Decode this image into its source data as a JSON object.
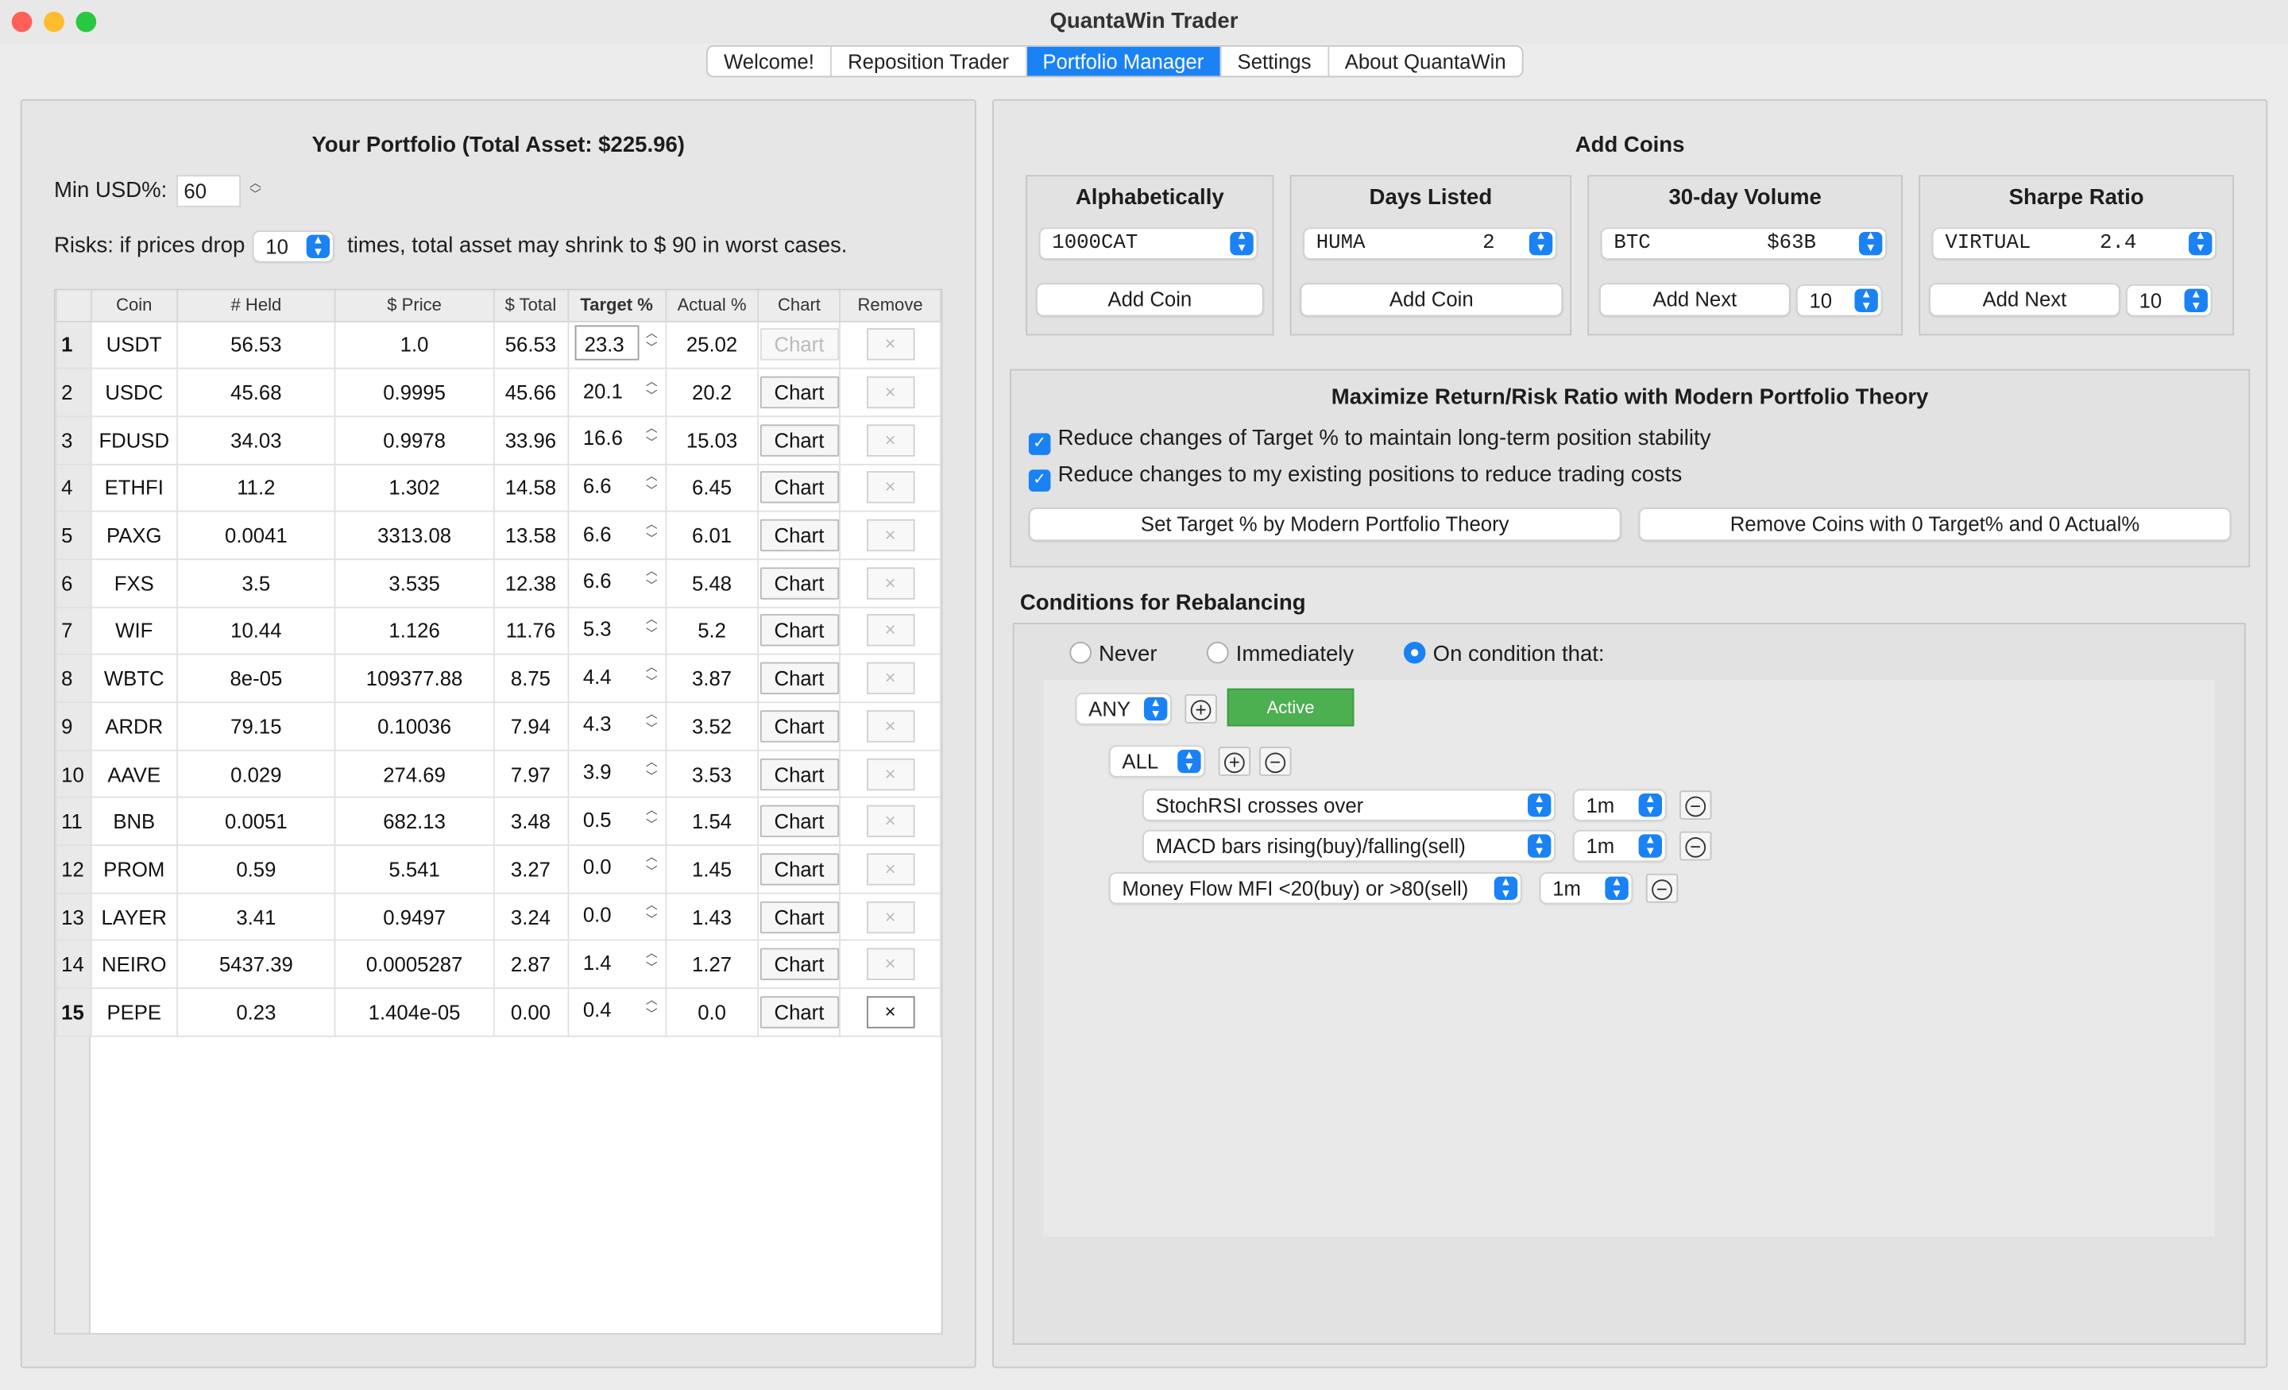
{
  "window": {
    "title": "QuantaWin Trader"
  },
  "tabs": [
    "Welcome!",
    "Reposition Trader",
    "Portfolio Manager",
    "Settings",
    "About QuantaWin"
  ],
  "portfolio": {
    "title": "Your Portfolio (Total Asset: $225.96)",
    "min_usd_label": "Min USD%:",
    "min_usd_value": "60",
    "risks_prefix": "Risks: if prices drop",
    "risks_times": "10",
    "risks_suffix": "times, total asset may shrink to $ 90  in worst cases.",
    "columns": [
      "Coin",
      "# Held",
      "$ Price",
      "$ Total",
      "Target %",
      "Actual %",
      "Chart",
      "Remove"
    ],
    "chart_label": "Chart",
    "remove_label": "×",
    "rows": [
      {
        "n": "1",
        "coin": "USDT",
        "held": "56.53",
        "price": "1.0",
        "total": "56.53",
        "target": "23.3",
        "actual": "25.02"
      },
      {
        "n": "2",
        "coin": "USDC",
        "held": "45.68",
        "price": "0.9995",
        "total": "45.66",
        "target": "20.1",
        "actual": "20.2"
      },
      {
        "n": "3",
        "coin": "FDUSD",
        "held": "34.03",
        "price": "0.9978",
        "total": "33.96",
        "target": "16.6",
        "actual": "15.03"
      },
      {
        "n": "4",
        "coin": "ETHFI",
        "held": "11.2",
        "price": "1.302",
        "total": "14.58",
        "target": "6.6",
        "actual": "6.45"
      },
      {
        "n": "5",
        "coin": "PAXG",
        "held": "0.0041",
        "price": "3313.08",
        "total": "13.58",
        "target": "6.6",
        "actual": "6.01"
      },
      {
        "n": "6",
        "coin": "FXS",
        "held": "3.5",
        "price": "3.535",
        "total": "12.38",
        "target": "6.6",
        "actual": "5.48"
      },
      {
        "n": "7",
        "coin": "WIF",
        "held": "10.44",
        "price": "1.126",
        "total": "11.76",
        "target": "5.3",
        "actual": "5.2"
      },
      {
        "n": "8",
        "coin": "WBTC",
        "held": "8e-05",
        "price": "109377.88",
        "total": "8.75",
        "target": "4.4",
        "actual": "3.87"
      },
      {
        "n": "9",
        "coin": "ARDR",
        "held": "79.15",
        "price": "0.10036",
        "total": "7.94",
        "target": "4.3",
        "actual": "3.52"
      },
      {
        "n": "10",
        "coin": "AAVE",
        "held": "0.029",
        "price": "274.69",
        "total": "7.97",
        "target": "3.9",
        "actual": "3.53"
      },
      {
        "n": "11",
        "coin": "BNB",
        "held": "0.0051",
        "price": "682.13",
        "total": "3.48",
        "target": "0.5",
        "actual": "1.54"
      },
      {
        "n": "12",
        "coin": "PROM",
        "held": "0.59",
        "price": "5.541",
        "total": "3.27",
        "target": "0.0",
        "actual": "1.45"
      },
      {
        "n": "13",
        "coin": "LAYER",
        "held": "3.41",
        "price": "0.9497",
        "total": "3.24",
        "target": "0.0",
        "actual": "1.43"
      },
      {
        "n": "14",
        "coin": "NEIRO",
        "held": "5437.39",
        "price": "0.0005287",
        "total": "2.87",
        "target": "1.4",
        "actual": "1.27"
      },
      {
        "n": "15",
        "coin": "PEPE",
        "held": "0.23",
        "price": "1.404e-05",
        "total": "0.00",
        "target": "0.4",
        "actual": "0.0"
      }
    ]
  },
  "add_coins": {
    "title": "Add Coins",
    "alpha": {
      "title": "Alphabetically",
      "select": "1000CAT",
      "button": "Add Coin"
    },
    "days": {
      "title": "Days Listed",
      "select": "HUMA",
      "select_value": "2",
      "button": "Add Coin"
    },
    "volume": {
      "title": "30-day Volume",
      "select": "BTC",
      "select_value": "$63B",
      "button": "Add Next",
      "count": "10"
    },
    "sharpe": {
      "title": "Sharpe Ratio",
      "select": "VIRTUAL",
      "select_value": "2.4",
      "button": "Add Next",
      "count": "10"
    }
  },
  "mpt": {
    "title": "Maximize Return/Risk Ratio with Modern Portfolio Theory",
    "check1": "Reduce changes of Target % to maintain long-term position stability",
    "check2": "Reduce changes to my existing positions to reduce trading costs",
    "btn_set": "Set Target % by Modern Portfolio Theory",
    "btn_remove": "Remove Coins with 0 Target% and 0 Actual%"
  },
  "rebalance": {
    "title": "Conditions for Rebalancing",
    "radio_never": "Never",
    "radio_immediately": "Immediately",
    "radio_condition": "On condition that:",
    "any": "ANY",
    "active": "Active",
    "all": "ALL",
    "conditions": [
      {
        "label": "StochRSI crosses over",
        "interval": "1m"
      },
      {
        "label": "MACD bars rising(buy)/falling(sell)",
        "interval": "1m"
      },
      {
        "label": "Money Flow MFI <20(buy) or >80(sell)",
        "interval": "1m"
      }
    ]
  },
  "icons": {
    "stepper": "up-down-chevrons",
    "combo": "blue-popup-chevrons",
    "add": "circled-plus",
    "remove": "circled-minus",
    "check": "checkmark"
  },
  "colors": {
    "accent": "#1a82f5",
    "active_green": "#4caf50"
  }
}
